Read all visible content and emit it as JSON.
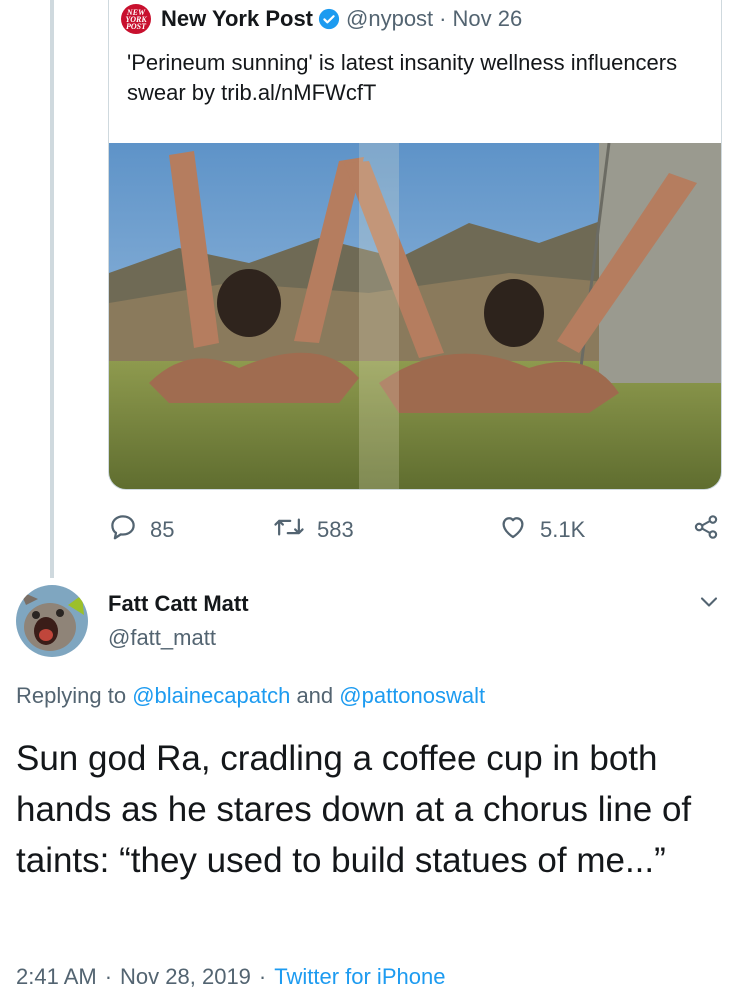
{
  "quoted_tweet": {
    "logo_lines": [
      "NEW",
      "YORK",
      "POST"
    ],
    "author_name": "New York Post",
    "author_handle": "@nypost",
    "separator": "·",
    "date": "Nov 26",
    "text": "'Perineum sunning' is latest insanity wellness influencers swear by trib.al/nMFWcfT",
    "media_icon": "photo",
    "verified": true
  },
  "actions": {
    "reply_count": "85",
    "retweet_count": "583",
    "like_count": "5.1K",
    "icons": [
      "reply-icon",
      "retweet-icon",
      "heart-icon",
      "share-icon"
    ]
  },
  "reply": {
    "author_name": "Fatt Catt Matt",
    "author_handle": "@fatt_matt",
    "replying_prefix": "Replying to",
    "mention_1": "@blainecapatch",
    "replying_and": "and",
    "mention_2": "@pattonoswalt",
    "text": "Sun god Ra, cradling a coffee cup in both hands as he stares down at a chorus line of taints: “they used to build statues of me...”",
    "time": "2:41 AM",
    "separator": "·",
    "date": "Nov 28, 2019",
    "source": "Twitter for iPhone"
  },
  "colors": {
    "link": "#1d9bf0",
    "secondary_text": "#536471",
    "primary_text": "#14171a",
    "verified": "#1d9bf0",
    "brand_red": "#c8102e"
  }
}
